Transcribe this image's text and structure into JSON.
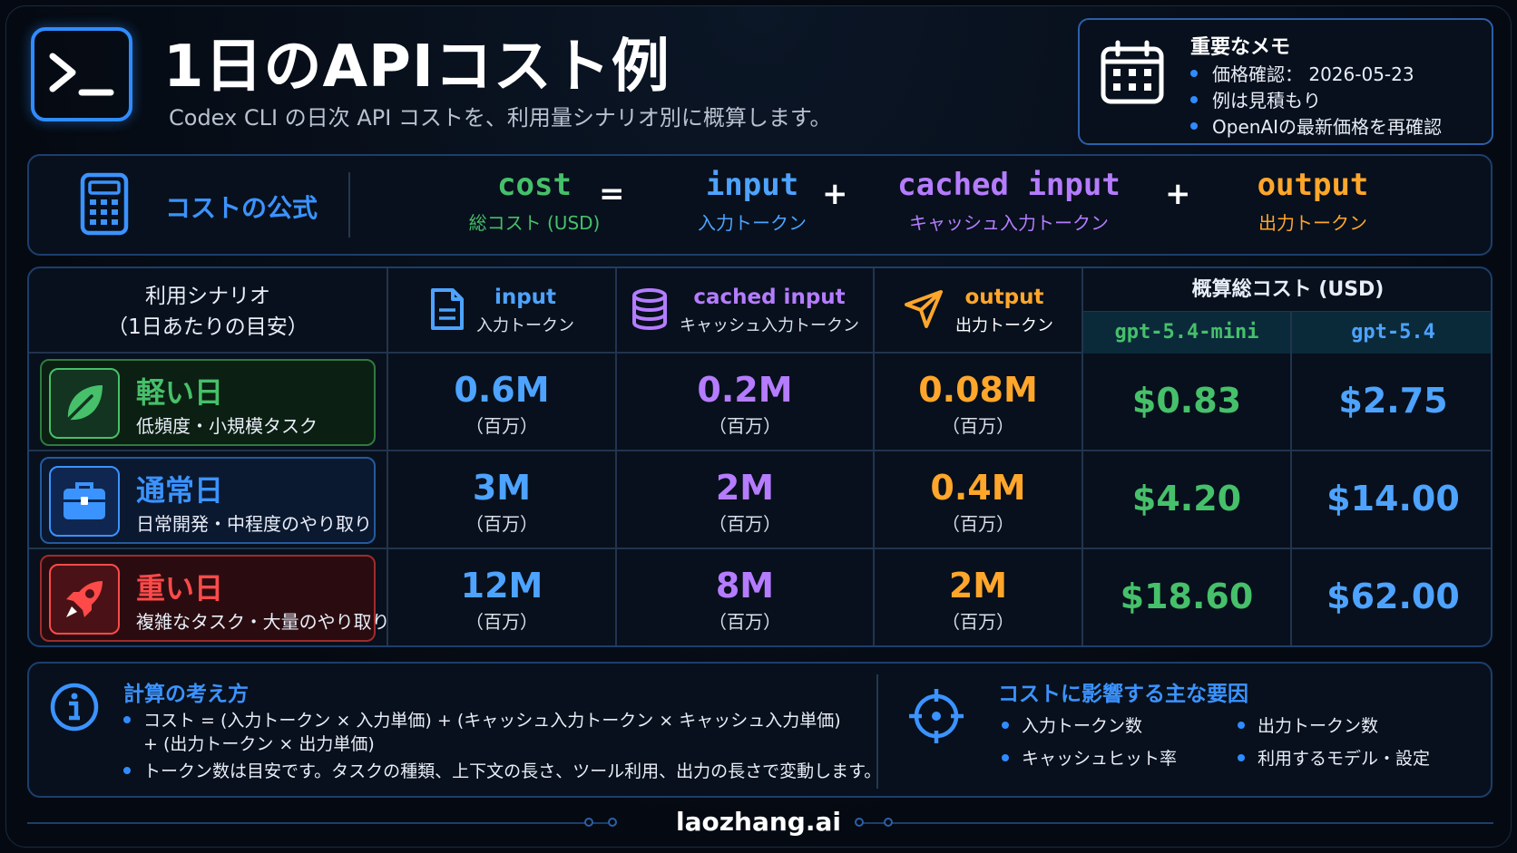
{
  "header": {
    "title": "1日のAPIコスト例",
    "subtitle": "Codex CLI の日次 API コストを、利用量シナリオ別に概算します。",
    "logo_icon": "terminal-prompt-icon"
  },
  "memo": {
    "title": "重要なメモ",
    "icon": "calendar-icon",
    "items": [
      "価格確認： 2026-05-23",
      "例は見積もり",
      "OpenAIの最新価格を再確認"
    ]
  },
  "formula": {
    "label": "コストの公式",
    "icon": "calculator-icon",
    "cost": {
      "code": "cost",
      "ja": "総コスト (USD)",
      "color": "#46c06a"
    },
    "input": {
      "code": "input",
      "ja": "入力トークン",
      "color": "#4da3ff"
    },
    "cached": {
      "code": "cached input",
      "ja": "キャッシュ入力トークン",
      "color": "#b57cff"
    },
    "output": {
      "code": "output",
      "ja": "出力トークン",
      "color": "#ffa62b"
    },
    "eq": "=",
    "plus": "+"
  },
  "table": {
    "scenario_header": [
      "利用シナリオ",
      "（1日あたりの目安）"
    ],
    "columns": [
      {
        "en": "input",
        "ja": "入力トークン",
        "icon": "document-icon",
        "color": "#4da3ff"
      },
      {
        "en": "cached input",
        "ja": "キャッシュ入力トークン",
        "icon": "database-icon",
        "color": "#b57cff"
      },
      {
        "en": "output",
        "ja": "出力トークン",
        "icon": "send-arrow-icon",
        "color": "#ffa62b"
      }
    ],
    "total_header": "概算総コスト (USD)",
    "models": [
      "gpt-5.4-mini",
      "gpt-5.4"
    ],
    "unit": "（百万）",
    "rows": [
      {
        "name": "軽い日",
        "desc": "低頻度・小規模タスク",
        "icon": "leaf-icon",
        "color": "#46c06a",
        "input": "0.6M",
        "cached": "0.2M",
        "output": "0.08M",
        "mini": "$0.83",
        "full": "$2.75"
      },
      {
        "name": "通常日",
        "desc": "日常開発・中程度のやり取り",
        "icon": "briefcase-icon",
        "color": "#3b93ff",
        "input": "3M",
        "cached": "2M",
        "output": "0.4M",
        "mini": "$4.20",
        "full": "$14.00"
      },
      {
        "name": "重い日",
        "desc": "複雑なタスク・大量のやり取り",
        "icon": "rocket-icon",
        "color": "#ff4a4a",
        "input": "12M",
        "cached": "8M",
        "output": "2M",
        "mini": "$18.60",
        "full": "$62.00"
      }
    ]
  },
  "notes": {
    "calc_title": "計算の考え方",
    "calc_icon": "info-icon",
    "calc_lines": [
      "コスト = (入力トークン × 入力単価) + (キャッシュ入力トークン × キャッシュ入力単価)",
      "+ (出力トークン × 出力単価)",
      "トークン数は目安です。タスクの種類、上下文の長さ、ツール利用、出力の長さで変動します。"
    ],
    "factors_title": "コストに影響する主な要因",
    "factors_icon": "target-icon",
    "factors": [
      "入力トークン数",
      "出力トークン数",
      "キャッシュヒット率",
      "利用するモデル・設定"
    ]
  },
  "footer": {
    "brand": "laozhang.ai"
  }
}
